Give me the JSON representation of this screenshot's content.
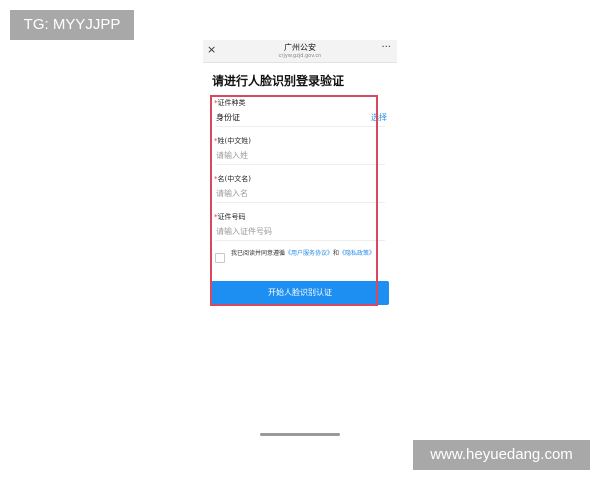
{
  "watermarks": {
    "top_left": "TG: MYYJJPP",
    "bottom_right": "www.heyuedang.com"
  },
  "nav": {
    "close_icon": "×",
    "title": "广州公安",
    "domain": "crjyw.gzjd.gov.cn",
    "more_icon": "···"
  },
  "page": {
    "title": "请进行人脸识别登录验证"
  },
  "form": {
    "required_mark": "*",
    "id_type": {
      "label": "证件种类",
      "value": "身份证",
      "select_label": "选择"
    },
    "surname": {
      "label": "姓(中文姓)",
      "placeholder": "请输入姓"
    },
    "given_name": {
      "label": "名(中文名)",
      "placeholder": "请输入名"
    },
    "id_number": {
      "label": "证件号码",
      "placeholder": "请输入证件号码"
    },
    "agreement": {
      "prefix": "我已阅读并同意遵循",
      "user_agreement_link": "《用户服务协议》",
      "and": "和",
      "privacy_link": "《隐私政策》"
    },
    "start_button_label": "开始人脸识别认证"
  },
  "colors": {
    "accent": "#1e8ff2",
    "link": "#2a8ce8",
    "required": "#e23b3b",
    "annotation": "#d9485f"
  }
}
